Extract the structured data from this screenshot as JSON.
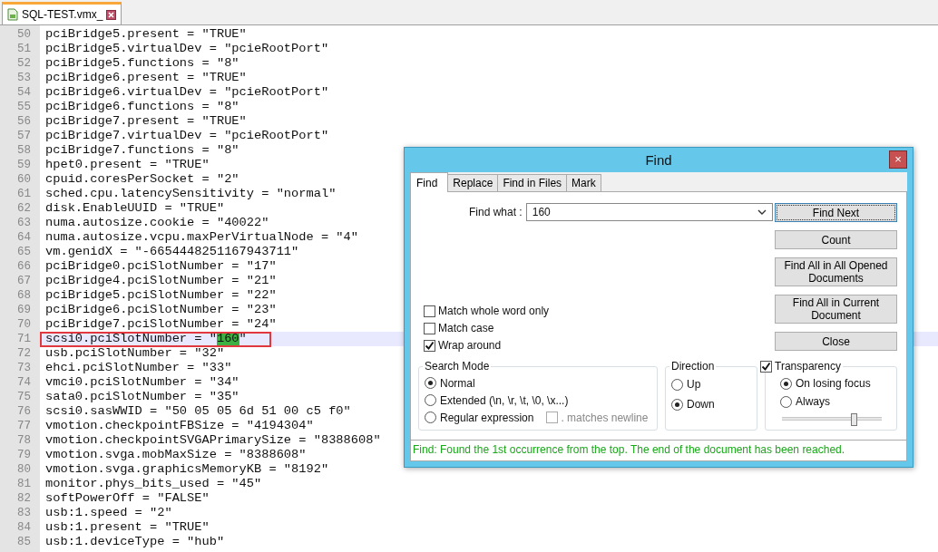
{
  "editor_tabs": [
    {
      "label": "SQL-TEST.vmx_",
      "selected": true
    }
  ],
  "lines": [
    {
      "n": "50",
      "text": "pciBridge5.present = \"TRUE\"",
      "current": false,
      "annotated": false
    },
    {
      "n": "51",
      "text": "pciBridge5.virtualDev = \"pcieRootPort\"",
      "current": false,
      "annotated": false
    },
    {
      "n": "52",
      "text": "pciBridge5.functions = \"8\"",
      "current": false,
      "annotated": false
    },
    {
      "n": "53",
      "text": "pciBridge6.present = \"TRUE\"",
      "current": false,
      "annotated": false
    },
    {
      "n": "54",
      "text": "pciBridge6.virtualDev = \"pcieRootPort\"",
      "current": false,
      "annotated": false
    },
    {
      "n": "55",
      "text": "pciBridge6.functions = \"8\"",
      "current": false,
      "annotated": false
    },
    {
      "n": "56",
      "text": "pciBridge7.present = \"TRUE\"",
      "current": false,
      "annotated": false
    },
    {
      "n": "57",
      "text": "pciBridge7.virtualDev = \"pcieRootPort\"",
      "current": false,
      "annotated": false
    },
    {
      "n": "58",
      "text": "pciBridge7.functions = \"8\"",
      "current": false,
      "annotated": false
    },
    {
      "n": "59",
      "text": "hpet0.present = \"TRUE\"",
      "current": false,
      "annotated": false
    },
    {
      "n": "60",
      "text": "cpuid.coresPerSocket = \"2\"",
      "current": false,
      "annotated": false
    },
    {
      "n": "61",
      "text": "sched.cpu.latencySensitivity = \"normal\"",
      "current": false,
      "annotated": false
    },
    {
      "n": "62",
      "text": "disk.EnableUUID = \"TRUE\"",
      "current": false,
      "annotated": false
    },
    {
      "n": "63",
      "text": "numa.autosize.cookie = \"40022\"",
      "current": false,
      "annotated": false
    },
    {
      "n": "64",
      "text": "numa.autosize.vcpu.maxPerVirtualNode = \"4\"",
      "current": false,
      "annotated": false
    },
    {
      "n": "65",
      "text": "vm.genidX = \"-6654448251167943711\"",
      "current": false,
      "annotated": false
    },
    {
      "n": "66",
      "text": "pciBridge0.pciSlotNumber = \"17\"",
      "current": false,
      "annotated": false
    },
    {
      "n": "67",
      "text": "pciBridge4.pciSlotNumber = \"21\"",
      "current": false,
      "annotated": false
    },
    {
      "n": "68",
      "text": "pciBridge5.pciSlotNumber = \"22\"",
      "current": false,
      "annotated": false
    },
    {
      "n": "69",
      "text": "pciBridge6.pciSlotNumber = \"23\"",
      "current": false,
      "annotated": false
    },
    {
      "n": "70",
      "text": "pciBridge7.pciSlotNumber = \"24\"",
      "current": false,
      "annotated": false
    },
    {
      "n": "71",
      "parts": [
        {
          "text": "scsi0.pciSlotNumber = \"",
          "match": false
        },
        {
          "text": "160",
          "match": true
        },
        {
          "text": "\"",
          "match": false
        }
      ],
      "current": true,
      "annotated": true
    },
    {
      "n": "72",
      "text": "usb.pciSlotNumber = \"32\"",
      "current": false,
      "annotated": false
    },
    {
      "n": "73",
      "text": "ehci.pciSlotNumber = \"33\"",
      "current": false,
      "annotated": false
    },
    {
      "n": "74",
      "text": "vmci0.pciSlotNumber = \"34\"",
      "current": false,
      "annotated": false
    },
    {
      "n": "75",
      "text": "sata0.pciSlotNumber = \"35\"",
      "current": false,
      "annotated": false
    },
    {
      "n": "76",
      "text": "scsi0.sasWWID = \"50 05 05 6d 51 00 c5 f0\"",
      "current": false,
      "annotated": false
    },
    {
      "n": "77",
      "text": "vmotion.checkpointFBSize = \"4194304\"",
      "current": false,
      "annotated": false
    },
    {
      "n": "78",
      "text": "vmotion.checkpointSVGAPrimarySize = \"8388608\"",
      "current": false,
      "annotated": false
    },
    {
      "n": "79",
      "text": "vmotion.svga.mobMaxSize = \"8388608\"",
      "current": false,
      "annotated": false
    },
    {
      "n": "80",
      "text": "vmotion.svga.graphicsMemoryKB = \"8192\"",
      "current": false,
      "annotated": false
    },
    {
      "n": "81",
      "text": "monitor.phys_bits_used = \"45\"",
      "current": false,
      "annotated": false
    },
    {
      "n": "82",
      "text": "softPowerOff = \"FALSE\"",
      "current": false,
      "annotated": false
    },
    {
      "n": "83",
      "text": "usb:1.speed = \"2\"",
      "current": false,
      "annotated": false
    },
    {
      "n": "84",
      "text": "usb:1.present = \"TRUE\"",
      "current": false,
      "annotated": false
    },
    {
      "n": "85",
      "text": "usb:1.deviceType = \"hub\"",
      "current": false,
      "annotated": false
    }
  ],
  "find_dialog": {
    "title": "Find",
    "close": "×",
    "tabs": [
      {
        "label": "Find",
        "selected": true
      },
      {
        "label": "Replace",
        "selected": false
      },
      {
        "label": "Find in Files",
        "selected": false
      },
      {
        "label": "Mark",
        "selected": false
      }
    ],
    "find_what": {
      "label": "Find what :",
      "value": "160"
    },
    "buttons": [
      {
        "label": "Find Next",
        "focused": true
      },
      {
        "label": "Count",
        "focused": false
      },
      {
        "label": "Find All in All Opened Documents",
        "focused": false
      },
      {
        "label": "Find All in Current Document",
        "focused": false
      },
      {
        "label": "Close",
        "focused": false
      }
    ],
    "options": [
      {
        "label": "Match whole word only",
        "checked": false
      },
      {
        "label": "Match case",
        "checked": false
      },
      {
        "label": "Wrap around",
        "checked": true
      }
    ],
    "search_mode": {
      "title": "Search Mode",
      "options": [
        {
          "label": "Normal",
          "selected": true
        },
        {
          "label": "Extended (\\n, \\r, \\t, \\0, \\x...)",
          "selected": false
        },
        {
          "label": "Regular expression",
          "selected": false
        }
      ],
      "dot_matches_newline": {
        "label": ". matches newline",
        "checked": false,
        "disabled": true
      }
    },
    "direction": {
      "title": "Direction",
      "options": [
        {
          "label": "Up",
          "selected": false
        },
        {
          "label": "Down",
          "selected": true
        }
      ]
    },
    "transparency": {
      "label": "Transparency",
      "checked": true,
      "options": [
        {
          "label": "On losing focus",
          "selected": true
        },
        {
          "label": "Always",
          "selected": false
        }
      ],
      "level": 0.72
    },
    "status": "Find: Found the 1st occurrence from the top. The end of the document has been reached."
  }
}
